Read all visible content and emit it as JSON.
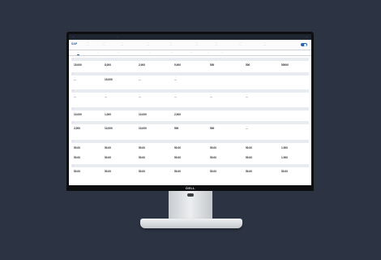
{
  "app": {
    "name": "…",
    "title": "…",
    "window_controls": "…"
  },
  "header": {
    "brand": "SAP",
    "fields": [
      {
        "label": "…",
        "value": "…"
      },
      {
        "label": "…",
        "value": "…"
      },
      {
        "label": "…",
        "value": "…"
      },
      {
        "label": "…",
        "value": "…"
      },
      {
        "label": "…",
        "value": "…"
      },
      {
        "label": "…",
        "value": "…"
      },
      {
        "label": "…",
        "value": "…"
      },
      {
        "label": "…",
        "value": "…"
      },
      {
        "label": "…",
        "value": "…"
      }
    ]
  },
  "tabs": [
    "…",
    "…",
    "…",
    "…",
    "…",
    "…",
    "…",
    "…"
  ],
  "sections": [
    "…",
    "…",
    "…",
    "…",
    "…",
    "…",
    "…"
  ],
  "fields": [
    {
      "label": "…",
      "value": "15,000"
    },
    {
      "label": "…",
      "value": "8,000"
    },
    {
      "label": "…",
      "value": "2,000"
    },
    {
      "label": "…",
      "value": "9,000"
    },
    {
      "label": "…",
      "value": "500"
    },
    {
      "label": "…",
      "value": "500"
    },
    {
      "label": "…",
      "value": "50000"
    },
    {
      "label": "…",
      "value": "…"
    },
    {
      "label": "…",
      "value": "15,000"
    },
    {
      "label": "…",
      "value": "…"
    },
    {
      "label": "…",
      "value": "…"
    },
    {
      "label": "…",
      "value": "…"
    },
    {
      "label": "…",
      "value": "…"
    },
    {
      "label": "…",
      "value": "…"
    },
    {
      "label": "…",
      "value": "…"
    },
    {
      "label": "…",
      "value": "…"
    },
    {
      "label": "…",
      "value": "…"
    },
    {
      "label": "…",
      "value": "10,000"
    },
    {
      "label": "…",
      "value": "1,000"
    },
    {
      "label": "…",
      "value": "10,000"
    },
    {
      "label": "…",
      "value": "2,000"
    },
    {
      "label": "…",
      "value": "2,000"
    },
    {
      "label": "…",
      "value": "10,000"
    },
    {
      "label": "…",
      "value": "10,000"
    },
    {
      "label": "…",
      "value": "500"
    },
    {
      "label": "…",
      "value": "500"
    },
    {
      "label": "…",
      "value": "…"
    },
    {
      "label": "…",
      "value": "50.00"
    },
    {
      "label": "…",
      "value": "50.00"
    },
    {
      "label": "…",
      "value": "50.00"
    },
    {
      "label": "…",
      "value": "50.00"
    },
    {
      "label": "…",
      "value": "50.00"
    },
    {
      "label": "…",
      "value": "50.00"
    },
    {
      "label": "…",
      "value": "1.000"
    },
    {
      "label": "…",
      "value": "50.00"
    },
    {
      "label": "…",
      "value": "50.00"
    },
    {
      "label": "…",
      "value": "50.00"
    },
    {
      "label": "…",
      "value": "50.00"
    },
    {
      "label": "…",
      "value": "50.00"
    },
    {
      "label": "…",
      "value": "50.00"
    },
    {
      "label": "…",
      "value": "1.000"
    },
    {
      "label": "…",
      "value": "50.00"
    },
    {
      "label": "…",
      "value": "50.00"
    },
    {
      "label": "…",
      "value": "50.00"
    },
    {
      "label": "…",
      "value": "50.00"
    },
    {
      "label": "…",
      "value": "50.00"
    },
    {
      "label": "…",
      "value": "50.00"
    },
    {
      "label": "…",
      "value": "50.00"
    }
  ],
  "monitor": {
    "brand": "DELL"
  }
}
